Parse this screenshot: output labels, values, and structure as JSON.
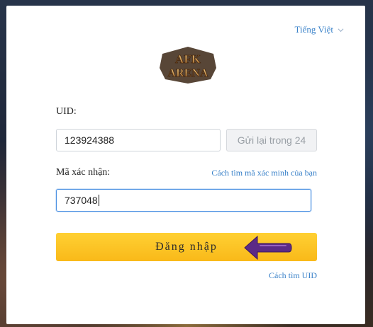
{
  "language": {
    "label": "Tiếng Việt"
  },
  "logo": {
    "text": "AFK ARENA"
  },
  "uid": {
    "label": "UID:",
    "value": "123924388",
    "resend_label": "Gửi lại trong 24"
  },
  "code": {
    "label": "Mã xác nhận:",
    "help_link": "Cách tìm mã xác minh của bạn",
    "value": "737048"
  },
  "login_button": {
    "label": "Đăng nhập"
  },
  "find_uid_link": "Cách tìm UID",
  "colors": {
    "accent": "#3a82c9",
    "button": "#f9b919",
    "arrow": "#5b2a86"
  }
}
